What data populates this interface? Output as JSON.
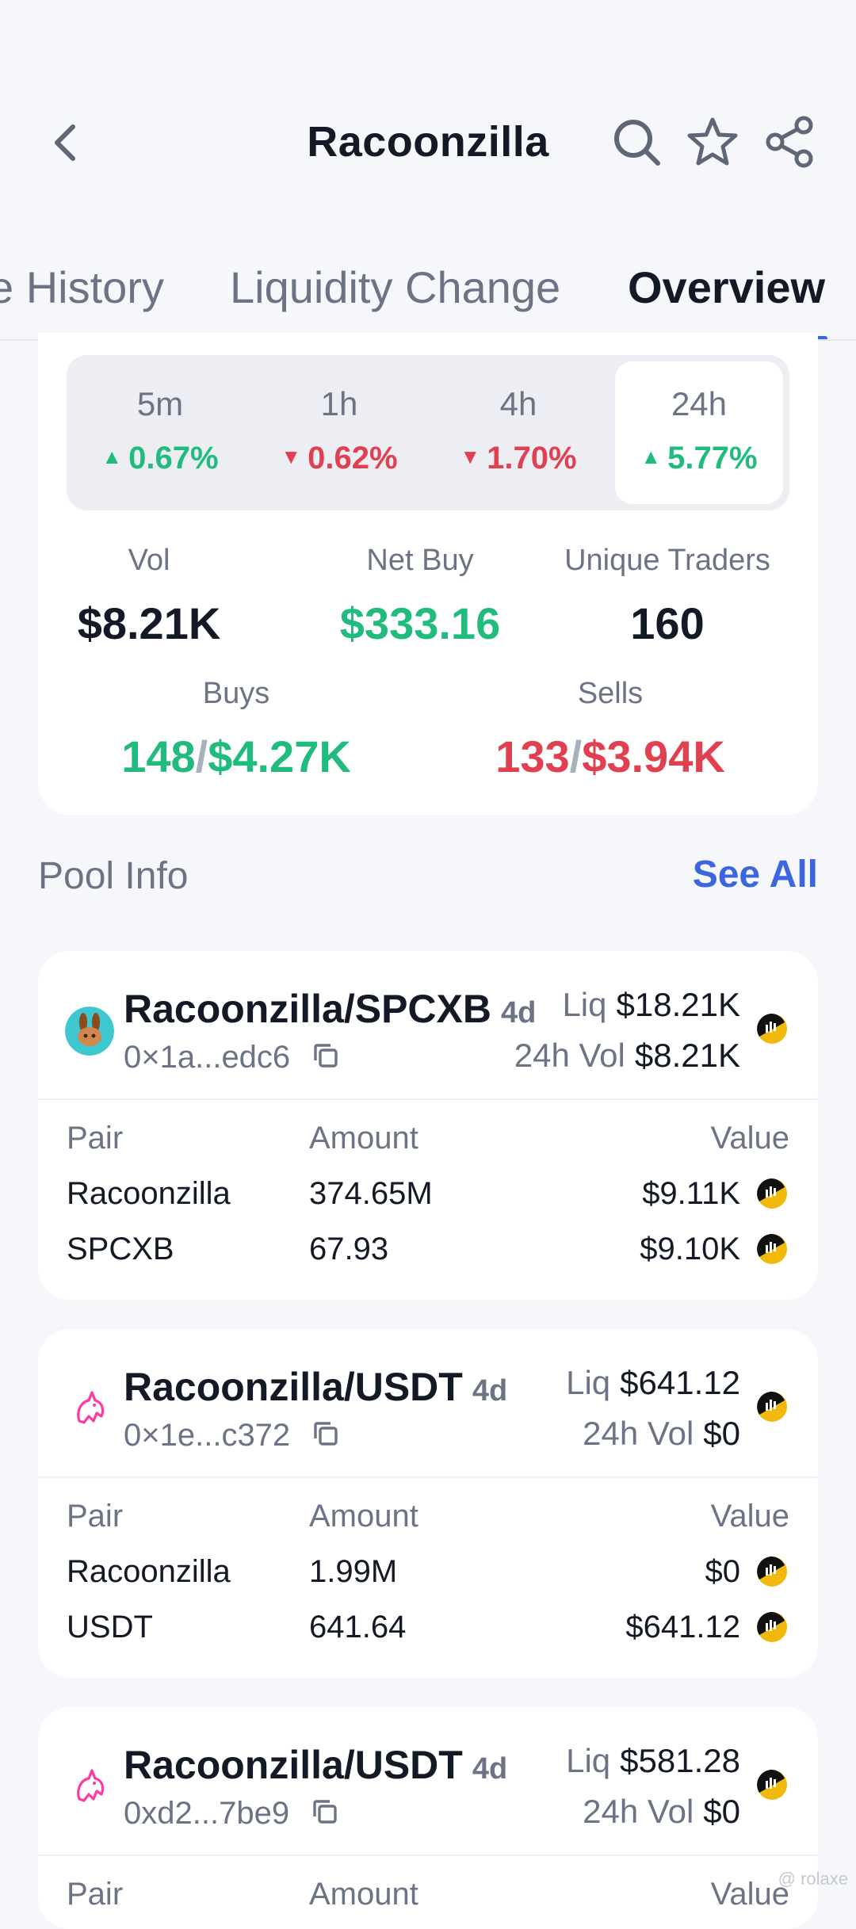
{
  "header": {
    "title": "Racoonzilla"
  },
  "tabs": [
    {
      "label": "e History",
      "active": false
    },
    {
      "label": "Liquidity Change",
      "active": false
    },
    {
      "label": "Overview",
      "active": true
    }
  ],
  "periods": [
    {
      "label": "5m",
      "change": "0.67%",
      "direction": "up",
      "selected": false
    },
    {
      "label": "1h",
      "change": "0.62%",
      "direction": "down",
      "selected": false
    },
    {
      "label": "4h",
      "change": "1.70%",
      "direction": "down",
      "selected": false
    },
    {
      "label": "24h",
      "change": "5.77%",
      "direction": "up",
      "selected": true
    }
  ],
  "metrics": {
    "vol": {
      "label": "Vol",
      "value": "$8.21K"
    },
    "net_buy": {
      "label": "Net Buy",
      "value": "$333.16"
    },
    "unique_traders": {
      "label": "Unique Traders",
      "value": "160"
    },
    "buys": {
      "label": "Buys",
      "count": "148",
      "amount": "$4.27K"
    },
    "sells": {
      "label": "Sells",
      "count": "133",
      "amount": "$3.94K"
    }
  },
  "pool_info": {
    "title": "Pool Info",
    "see_all": "See All"
  },
  "table_headers": {
    "pair": "Pair",
    "amount": "Amount",
    "value": "Value"
  },
  "pools": [
    {
      "name": "Racoonzilla/SPCXB",
      "age": "4d",
      "address": "0×1a...edc6",
      "liq_label": "Liq",
      "liq": "$18.21K",
      "vol_label": "24h Vol",
      "vol": "$8.21K",
      "dex_icon": "pancakeswap-bunny-icon",
      "rows": [
        {
          "pair": "Racoonzilla",
          "amount": "374.65M",
          "value": "$9.11K"
        },
        {
          "pair": "SPCXB",
          "amount": "67.93",
          "value": "$9.10K"
        }
      ]
    },
    {
      "name": "Racoonzilla/USDT",
      "age": "4d",
      "address": "0×1e...c372",
      "liq_label": "Liq",
      "liq": "$641.12",
      "vol_label": "24h Vol",
      "vol": "$0",
      "dex_icon": "uniswap-unicorn-icon",
      "rows": [
        {
          "pair": "Racoonzilla",
          "amount": "1.99M",
          "value": "$0"
        },
        {
          "pair": "USDT",
          "amount": "641.64",
          "value": "$641.12"
        }
      ]
    },
    {
      "name": "Racoonzilla/USDT",
      "age": "4d",
      "address": "0xd2...7be9",
      "liq_label": "Liq",
      "liq": "$581.28",
      "vol_label": "24h Vol",
      "vol": "$0",
      "dex_icon": "uniswap-unicorn-icon",
      "rows": []
    }
  ],
  "watermark": "@ rolaxe",
  "colors": {
    "up": "#22bb7e",
    "down": "#e0404f",
    "accent": "#3b66e0",
    "muted": "#6b7385"
  }
}
